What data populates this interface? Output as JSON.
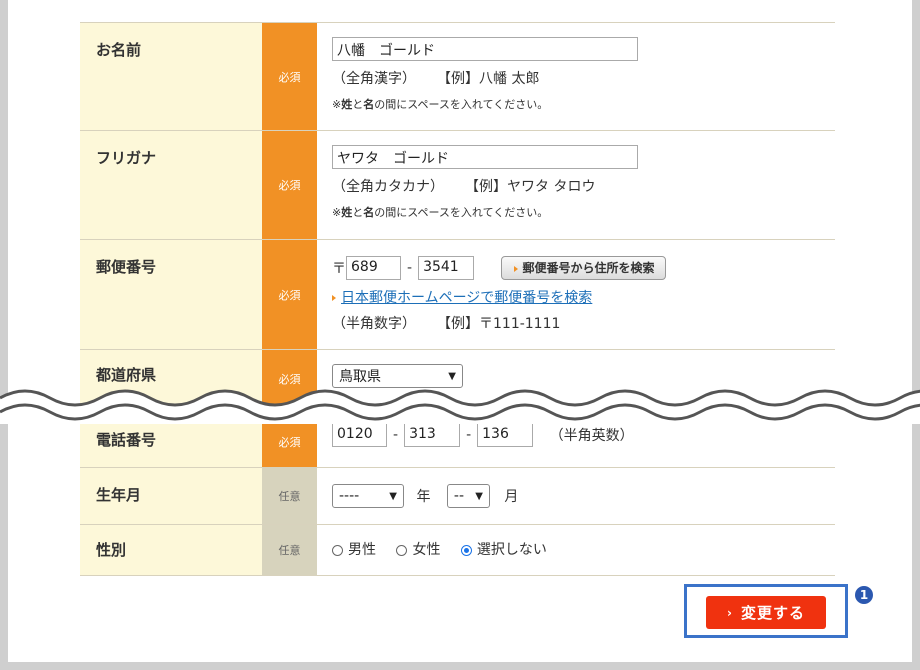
{
  "form": {
    "required_label": "必須",
    "optional_label": "任意",
    "name": {
      "label": "お名前",
      "value": "八幡　ゴールド",
      "note_type": "（全角漢字）",
      "note_example": "【例】八幡 太郎",
      "note_space_pre": "※",
      "note_space_b1": "姓",
      "note_space_mid": "と",
      "note_space_b2": "名",
      "note_space_post": "の間にスペースを入れてください。"
    },
    "kana": {
      "label": "フリガナ",
      "value": "ヤワタ　ゴールド",
      "note_type": "（全角カタカナ）",
      "note_example": "【例】ヤワタ タロウ",
      "note_space_pre": "※",
      "note_space_b1": "姓",
      "note_space_mid": "と",
      "note_space_b2": "名",
      "note_space_post": "の間にスペースを入れてください。"
    },
    "zip": {
      "label": "郵便番号",
      "mark": "〒",
      "value1": "689",
      "value2": "3541",
      "search_button": "郵便番号から住所を検索",
      "link": "日本郵便ホームページで郵便番号を検索",
      "note_type": "（半角数字）",
      "note_example": "【例】〒111-1111"
    },
    "pref": {
      "label": "都道府県",
      "value": "鳥取県"
    },
    "tel": {
      "label": "電話番号",
      "value1": "0120",
      "value2": "313",
      "value3": "136",
      "note": "（半角英数）"
    },
    "birth": {
      "label": "生年月",
      "year_value": "----",
      "year_unit": "年",
      "month_value": "--",
      "month_unit": "月"
    },
    "gender": {
      "label": "性別",
      "options": [
        "男性",
        "女性",
        "選択しない"
      ],
      "selected": "選択しない"
    }
  },
  "submit": {
    "label": "変更する",
    "badge": "1"
  }
}
